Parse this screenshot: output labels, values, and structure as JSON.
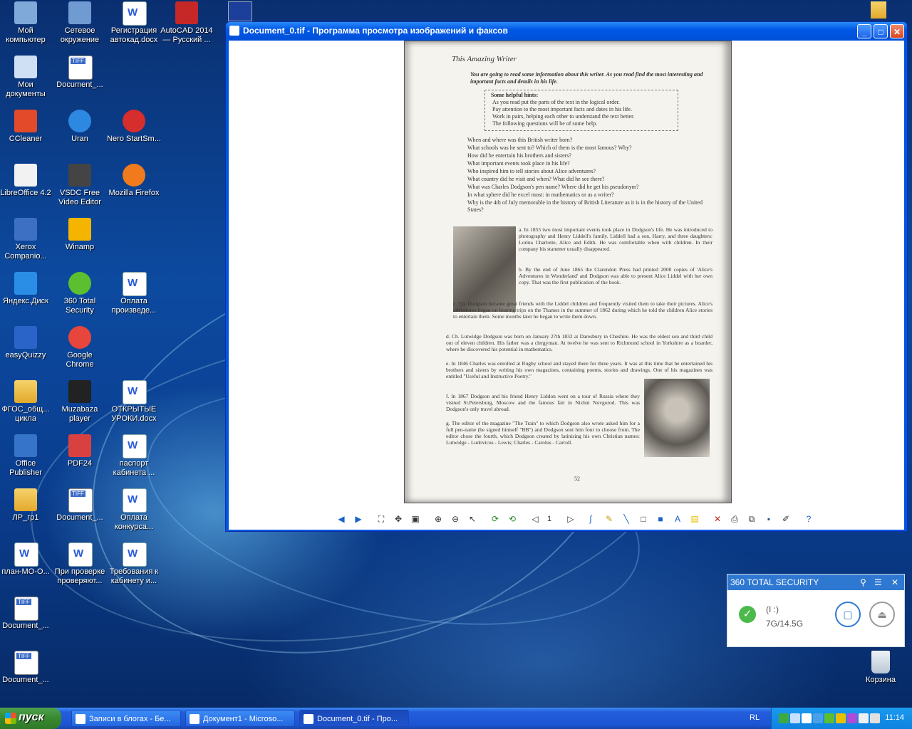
{
  "desktop": {
    "icons": [
      {
        "label": "Мой компьютер",
        "col": 0,
        "row": 0,
        "kind": "pc"
      },
      {
        "label": "Мои документы",
        "col": 0,
        "row": 1,
        "kind": "mydocs"
      },
      {
        "label": "CCleaner",
        "col": 0,
        "row": 2,
        "kind": "ccleaner"
      },
      {
        "label": "LibreOffice 4.2",
        "col": 0,
        "row": 3,
        "kind": "libre"
      },
      {
        "label": "Xerox Companio...",
        "col": 0,
        "row": 4,
        "kind": "xerox"
      },
      {
        "label": "Яндекс.Диск",
        "col": 0,
        "row": 5,
        "kind": "yadisk"
      },
      {
        "label": "easyQuizzy",
        "col": 0,
        "row": 6,
        "kind": "quiz"
      },
      {
        "label": "ФГОС_общ... цикла",
        "col": 0,
        "row": 7,
        "kind": "folder"
      },
      {
        "label": "Office Publisher",
        "col": 0,
        "row": 8,
        "kind": "publisher"
      },
      {
        "label": "ЛР_гр1",
        "col": 0,
        "row": 9,
        "kind": "folder"
      },
      {
        "label": "план-МО-О...",
        "col": 0,
        "row": 10,
        "kind": "doc"
      },
      {
        "label": "Document_...",
        "col": 0,
        "row": 11,
        "kind": "tiff"
      },
      {
        "label": "Document_...",
        "col": 0,
        "row": 12,
        "kind": "tiff"
      },
      {
        "label": "Сетевое окружение",
        "col": 1,
        "row": 0,
        "kind": "net"
      },
      {
        "label": "Document_...",
        "col": 1,
        "row": 1,
        "kind": "tiff"
      },
      {
        "label": "Uran",
        "col": 1,
        "row": 2,
        "kind": "uran"
      },
      {
        "label": "VSDC Free Video Editor",
        "col": 1,
        "row": 3,
        "kind": "vsdc"
      },
      {
        "label": "Winamp",
        "col": 1,
        "row": 4,
        "kind": "winamp"
      },
      {
        "label": "360 Total Security",
        "col": 1,
        "row": 5,
        "kind": "s360"
      },
      {
        "label": "Google Chrome",
        "col": 1,
        "row": 6,
        "kind": "chrome"
      },
      {
        "label": "Muzabaza player",
        "col": 1,
        "row": 7,
        "kind": "muza"
      },
      {
        "label": "PDF24",
        "col": 1,
        "row": 8,
        "kind": "pdf24"
      },
      {
        "label": "Document_...",
        "col": 1,
        "row": 9,
        "kind": "tiff"
      },
      {
        "label": "При проверке проверяют...",
        "col": 1,
        "row": 10,
        "kind": "doc"
      },
      {
        "label": "Регистрация автокад.docx",
        "col": 2,
        "row": 0,
        "kind": "doc"
      },
      {
        "label": "Nero StartSm...",
        "col": 2,
        "row": 2,
        "kind": "nero"
      },
      {
        "label": "Mozilla Firefox",
        "col": 2,
        "row": 3,
        "kind": "firefox"
      },
      {
        "label": "Оплата произведе...",
        "col": 2,
        "row": 5,
        "kind": "doc"
      },
      {
        "label": "ОТКРЫТЫЕ УРОКИ.docx",
        "col": 2,
        "row": 7,
        "kind": "doc"
      },
      {
        "label": "паспорт кабинета ...",
        "col": 2,
        "row": 8,
        "kind": "doc"
      },
      {
        "label": "Оплата конкурса...",
        "col": 2,
        "row": 9,
        "kind": "doc"
      },
      {
        "label": "Требования к кабинету и...",
        "col": 2,
        "row": 10,
        "kind": "doc"
      },
      {
        "label": "AutoCAD 2014 — Русский ...",
        "col": 3,
        "row": 0,
        "kind": "autocad"
      }
    ],
    "recycle_label": "Корзина"
  },
  "window": {
    "title": "Document_0.tif - Программа просмотра изображений и факсов",
    "minimize": "_",
    "maximize": "□",
    "close": "✕",
    "page_number": "1"
  },
  "document": {
    "heading": "This Amazing Writer",
    "intro": "You are going to read some information about this writer. As you read find the most interesting and important facts and details in his life.",
    "hints_title": "Some helpful hints:",
    "hints": [
      "As you read put the parts of the text in the logical order.",
      "Pay attention to the most important facts and dates in his life.",
      "Work in pairs, helping each other to understand the text better.",
      "The following questions will be of some help."
    ],
    "questions": [
      "When and where was this British writer born?",
      "What schools was he sent to? Which of them is the most famous? Why?",
      "How did he entertain his brothers and sisters?",
      "What important events took place in his life?",
      "Who inspired him to tell stories about Alice adventures?",
      "What country did he visit and when? What did he see there?",
      "What was Charles Dodgson's pen name? Where did he get his pseudonym?",
      "In what sphere did he excel most: in mathematics or as a writer?",
      "Why is the 4th of July memorable in the history of British Literature as it is in the history of the United States?"
    ],
    "paragraphs": [
      "a. In 1855 two most important events took place in Dodgson's life. He was introduced to photography and Henry Liddell's family. Liddell had a son, Harry, and three daughters: Lorina Charlotte, Alice and Edith. He was comfortable when with children. In their company his stammer usually disappeared.",
      "b. By the end of June 1865 the Clarendon Press had printed 2000 copies of 'Alice's Adventures in Wonderland' and Dodgson was able to present Alice Liddel with her own copy. That was the first publication of the book.",
      "c. Ch. Dodgson became great friends with the Liddel children and frequently visited them to take their pictures. Alice's adventures began on boating trips on the Thames in the summer of 1862 during which he told the children Alice stories to entertain them. Some months later he began to write them down.",
      "d. Ch. Lutwidge Dodgson was born on January 27th 1832 at Daresbury in Cheshire. He was the eldest son and third child out of eleven children. His father was a clergyman. At twelve he was sent to Richmond school in Yorkshire as a boarder, where he discovered his potential in mathematics.",
      "e. In 1846 Charles was enrolled at Rugby school and stayed there for three years. It was at this time that he entertained his brothers and sisters by writing his own magazines, containing poems, stories and drawings. One of his magazines was entitled \"Useful and Instructive Poetry.\"",
      "f. In 1867 Dodgson and his friend Henry Liddon went on a tour of Russia where they visited St.Petersburg, Moscow and the famous fair in Nizhni Novgorod. This was Dodgson's only travel abroad.",
      "g. The editor of the magazine \"The Train\" to which Dodgson also wrote asked him for a full pen-name (he signed himself \"BB\") and Dodgson sent him four to choose from. The editor chose the fourth, which Dodgson created by latinising his own Christian names: Lutwidge - Ludovicus - Lewis; Charles - Carolus - Carroll."
    ],
    "page_no": "52"
  },
  "security": {
    "title": "360 TOTAL SECURITY",
    "drive": "(I :)",
    "size": "7G/14.5G"
  },
  "taskbar": {
    "start": "пуск",
    "tasks": [
      "Записи в блогах - Бе...",
      "Документ1 - Microso...",
      "Document_0.tif - Про..."
    ],
    "lang": "RL",
    "clock": "11:14"
  }
}
